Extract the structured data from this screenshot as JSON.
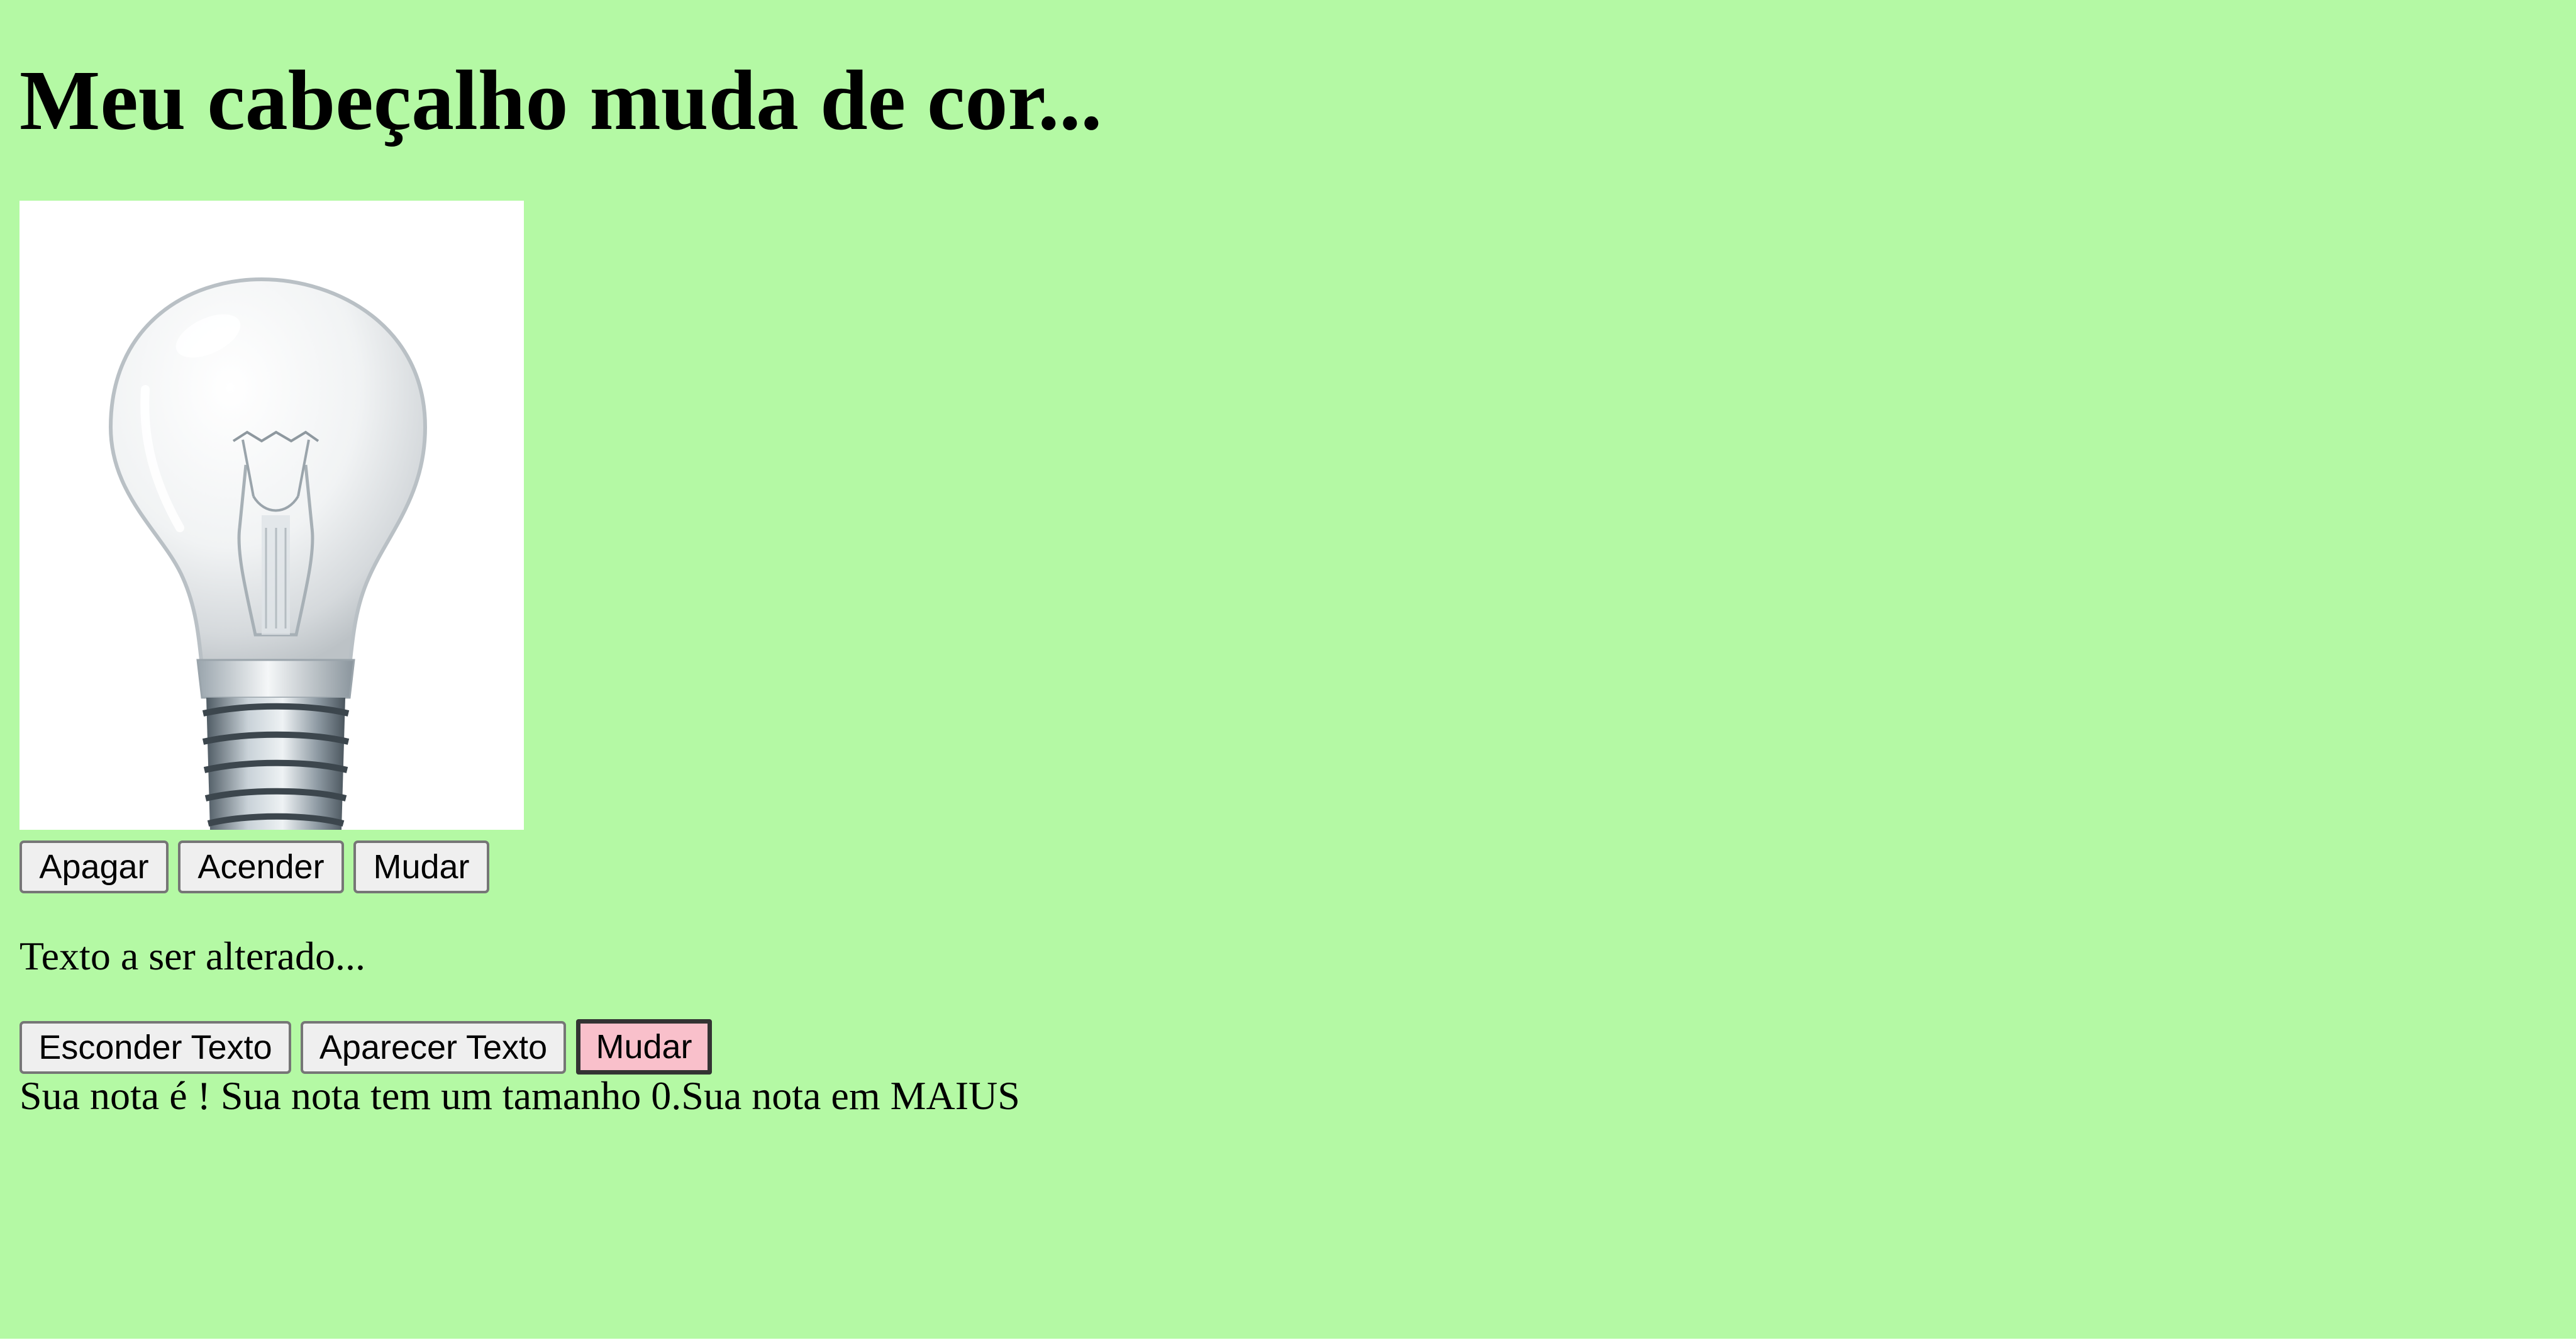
{
  "header": {
    "title": "Meu cabeçalho muda de cor..."
  },
  "lamp": {
    "image_icon": "lightbulb-icon",
    "buttons": {
      "off_label": "Apagar",
      "on_label": "Acender",
      "change_label": "Mudar"
    }
  },
  "text_section": {
    "paragraph": "Texto a ser alterado...",
    "buttons": {
      "hide_label": "Esconder Texto",
      "show_label": "Aparecer Texto",
      "change_label": "Mudar"
    }
  },
  "grade": {
    "summary": "Sua nota é ! Sua nota tem um tamanho 0.Sua nota em MAIUS"
  },
  "colors": {
    "page_background": "#b4f9a4",
    "active_button_background": "#f9c0cb"
  }
}
